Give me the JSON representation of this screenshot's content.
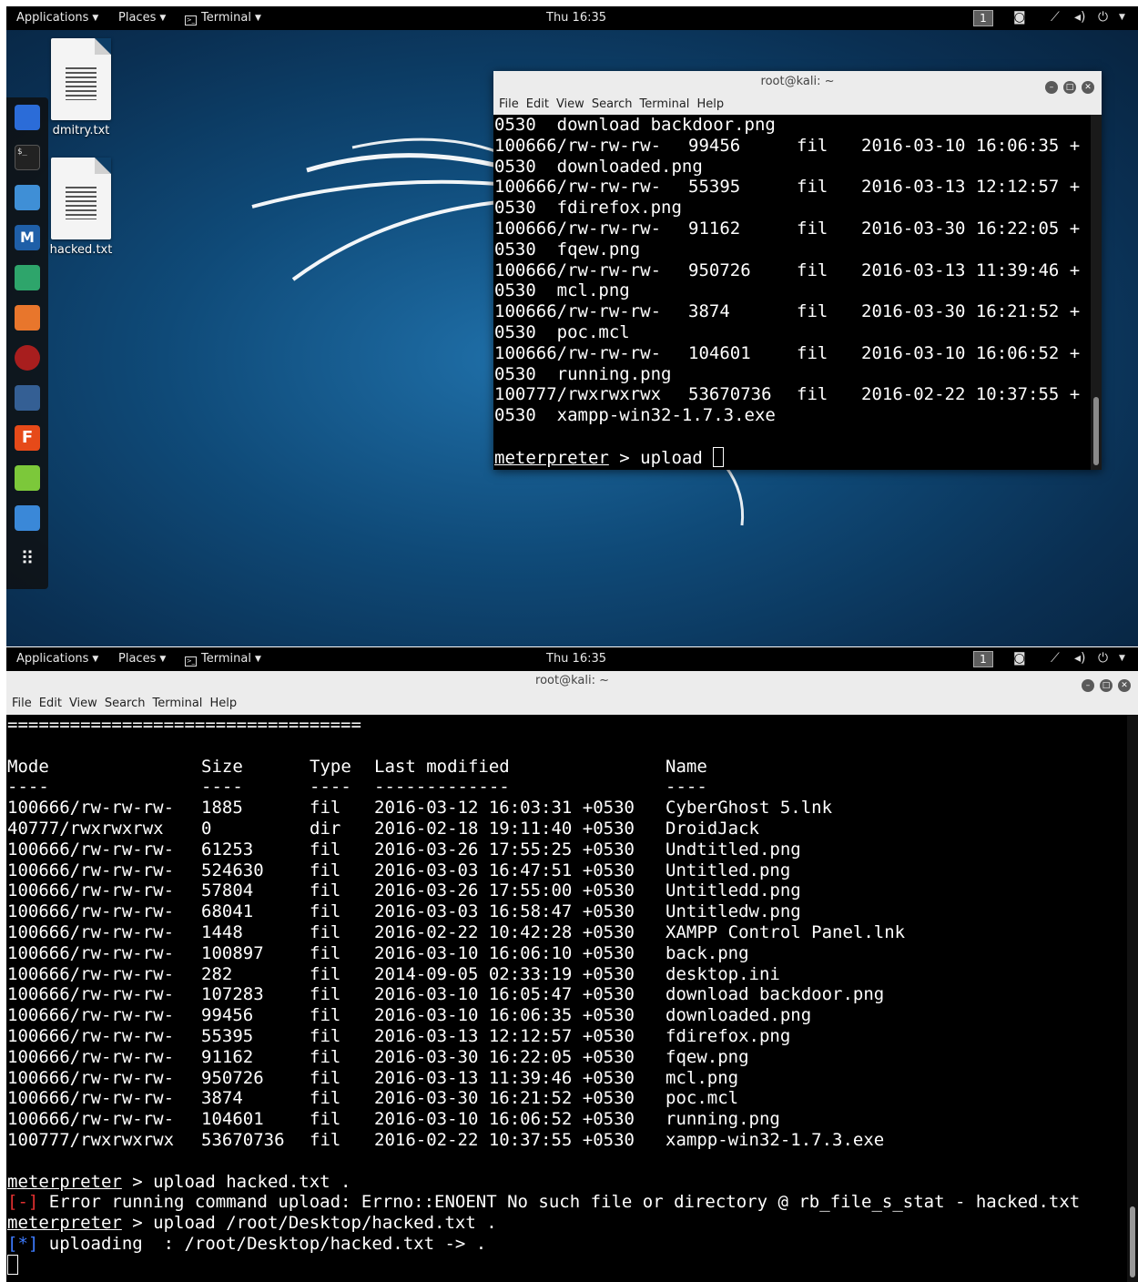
{
  "panel": {
    "applications": "Applications",
    "places": "Places",
    "terminal": "Terminal",
    "clock": "Thu 16:35",
    "workspace": "1"
  },
  "desktop": {
    "icons": [
      {
        "label": "dmitry.txt"
      },
      {
        "label": "hacked.txt"
      }
    ]
  },
  "dock": {
    "icons": [
      "maltego-icon",
      "terminal-icon",
      "files-icon",
      "metasploit-icon",
      "armitage-icon",
      "burpsuite-icon",
      "faraday-icon",
      "beef-icon",
      "leafpad-icon",
      "screenshot-icon",
      "show-apps-icon"
    ]
  },
  "window": {
    "title": "root@kali: ~",
    "menu": [
      "File",
      "Edit",
      "View",
      "Search",
      "Terminal",
      "Help"
    ]
  },
  "top_terminal": {
    "rows": [
      {
        "a": "0530  download backdoor.png"
      },
      {
        "a": "100666/rw-rw-rw-",
        "b": "99456",
        "c": "fil",
        "d": "2016-03-10 16:06:35 +"
      },
      {
        "a": "0530  downloaded.png"
      },
      {
        "a": "100666/rw-rw-rw-",
        "b": "55395",
        "c": "fil",
        "d": "2016-03-13 12:12:57 +"
      },
      {
        "a": "0530  fdirefox.png"
      },
      {
        "a": "100666/rw-rw-rw-",
        "b": "91162",
        "c": "fil",
        "d": "2016-03-30 16:22:05 +"
      },
      {
        "a": "0530  fqew.png"
      },
      {
        "a": "100666/rw-rw-rw-",
        "b": "950726",
        "c": "fil",
        "d": "2016-03-13 11:39:46 +"
      },
      {
        "a": "0530  mcl.png"
      },
      {
        "a": "100666/rw-rw-rw-",
        "b": "3874",
        "c": "fil",
        "d": "2016-03-30 16:21:52 +"
      },
      {
        "a": "0530  poc.mcl"
      },
      {
        "a": "100666/rw-rw-rw-",
        "b": "104601",
        "c": "fil",
        "d": "2016-03-10 16:06:52 +"
      },
      {
        "a": "0530  running.png"
      },
      {
        "a": "100777/rwxrwxrwx",
        "b": "53670736",
        "c": "fil",
        "d": "2016-02-22 10:37:55 +"
      },
      {
        "a": "0530  xampp-win32-1.7.3.exe"
      }
    ],
    "prompt": "meterpreter",
    "command": " > upload "
  },
  "bottom_terminal": {
    "rule": "==================================",
    "headers": {
      "mode": "Mode",
      "size": "Size",
      "type": "Type",
      "modified": "Last modified",
      "name": "Name"
    },
    "dashes": {
      "mode": "----",
      "size": "----",
      "type": "----",
      "modified": "-------------",
      "name": "----"
    },
    "rows": [
      {
        "mode": "100666/rw-rw-rw-",
        "size": "1885",
        "type": "fil",
        "modified": "2016-03-12 16:03:31 +0530",
        "name": "CyberGhost 5.lnk"
      },
      {
        "mode": "40777/rwxrwxrwx",
        "size": "0",
        "type": "dir",
        "modified": "2016-02-18 19:11:40 +0530",
        "name": "DroidJack"
      },
      {
        "mode": "100666/rw-rw-rw-",
        "size": "61253",
        "type": "fil",
        "modified": "2016-03-26 17:55:25 +0530",
        "name": "Undtitled.png"
      },
      {
        "mode": "100666/rw-rw-rw-",
        "size": "524630",
        "type": "fil",
        "modified": "2016-03-03 16:47:51 +0530",
        "name": "Untitled.png"
      },
      {
        "mode": "100666/rw-rw-rw-",
        "size": "57804",
        "type": "fil",
        "modified": "2016-03-26 17:55:00 +0530",
        "name": "Untitledd.png"
      },
      {
        "mode": "100666/rw-rw-rw-",
        "size": "68041",
        "type": "fil",
        "modified": "2016-03-03 16:58:47 +0530",
        "name": "Untitledw.png"
      },
      {
        "mode": "100666/rw-rw-rw-",
        "size": "1448",
        "type": "fil",
        "modified": "2016-02-22 10:42:28 +0530",
        "name": "XAMPP Control Panel.lnk"
      },
      {
        "mode": "100666/rw-rw-rw-",
        "size": "100897",
        "type": "fil",
        "modified": "2016-03-10 16:06:10 +0530",
        "name": "back.png"
      },
      {
        "mode": "100666/rw-rw-rw-",
        "size": "282",
        "type": "fil",
        "modified": "2014-09-05 02:33:19 +0530",
        "name": "desktop.ini"
      },
      {
        "mode": "100666/rw-rw-rw-",
        "size": "107283",
        "type": "fil",
        "modified": "2016-03-10 16:05:47 +0530",
        "name": "download backdoor.png"
      },
      {
        "mode": "100666/rw-rw-rw-",
        "size": "99456",
        "type": "fil",
        "modified": "2016-03-10 16:06:35 +0530",
        "name": "downloaded.png"
      },
      {
        "mode": "100666/rw-rw-rw-",
        "size": "55395",
        "type": "fil",
        "modified": "2016-03-13 12:12:57 +0530",
        "name": "fdirefox.png"
      },
      {
        "mode": "100666/rw-rw-rw-",
        "size": "91162",
        "type": "fil",
        "modified": "2016-03-30 16:22:05 +0530",
        "name": "fqew.png"
      },
      {
        "mode": "100666/rw-rw-rw-",
        "size": "950726",
        "type": "fil",
        "modified": "2016-03-13 11:39:46 +0530",
        "name": "mcl.png"
      },
      {
        "mode": "100666/rw-rw-rw-",
        "size": "3874",
        "type": "fil",
        "modified": "2016-03-30 16:21:52 +0530",
        "name": "poc.mcl"
      },
      {
        "mode": "100666/rw-rw-rw-",
        "size": "104601",
        "type": "fil",
        "modified": "2016-03-10 16:06:52 +0530",
        "name": "running.png"
      },
      {
        "mode": "100777/rwxrwxrwx",
        "size": "53670736",
        "type": "fil",
        "modified": "2016-02-22 10:37:55 +0530",
        "name": "xampp-win32-1.7.3.exe"
      }
    ],
    "log": [
      {
        "prompt": "meterpreter",
        "text": " > upload hacked.txt ."
      },
      {
        "marker": "[-]",
        "text": " Error running command upload: Errno::ENOENT No such file or directory @ rb_file_s_stat - hacked.txt"
      },
      {
        "prompt": "meterpreter",
        "text": " > upload /root/Desktop/hacked.txt ."
      },
      {
        "marker": "[*]",
        "text": " uploading  : /root/Desktop/hacked.txt -> ."
      }
    ]
  },
  "colors": {
    "error": "#e23030",
    "info": "#3d7bff",
    "terminal_bg": "#000000"
  }
}
